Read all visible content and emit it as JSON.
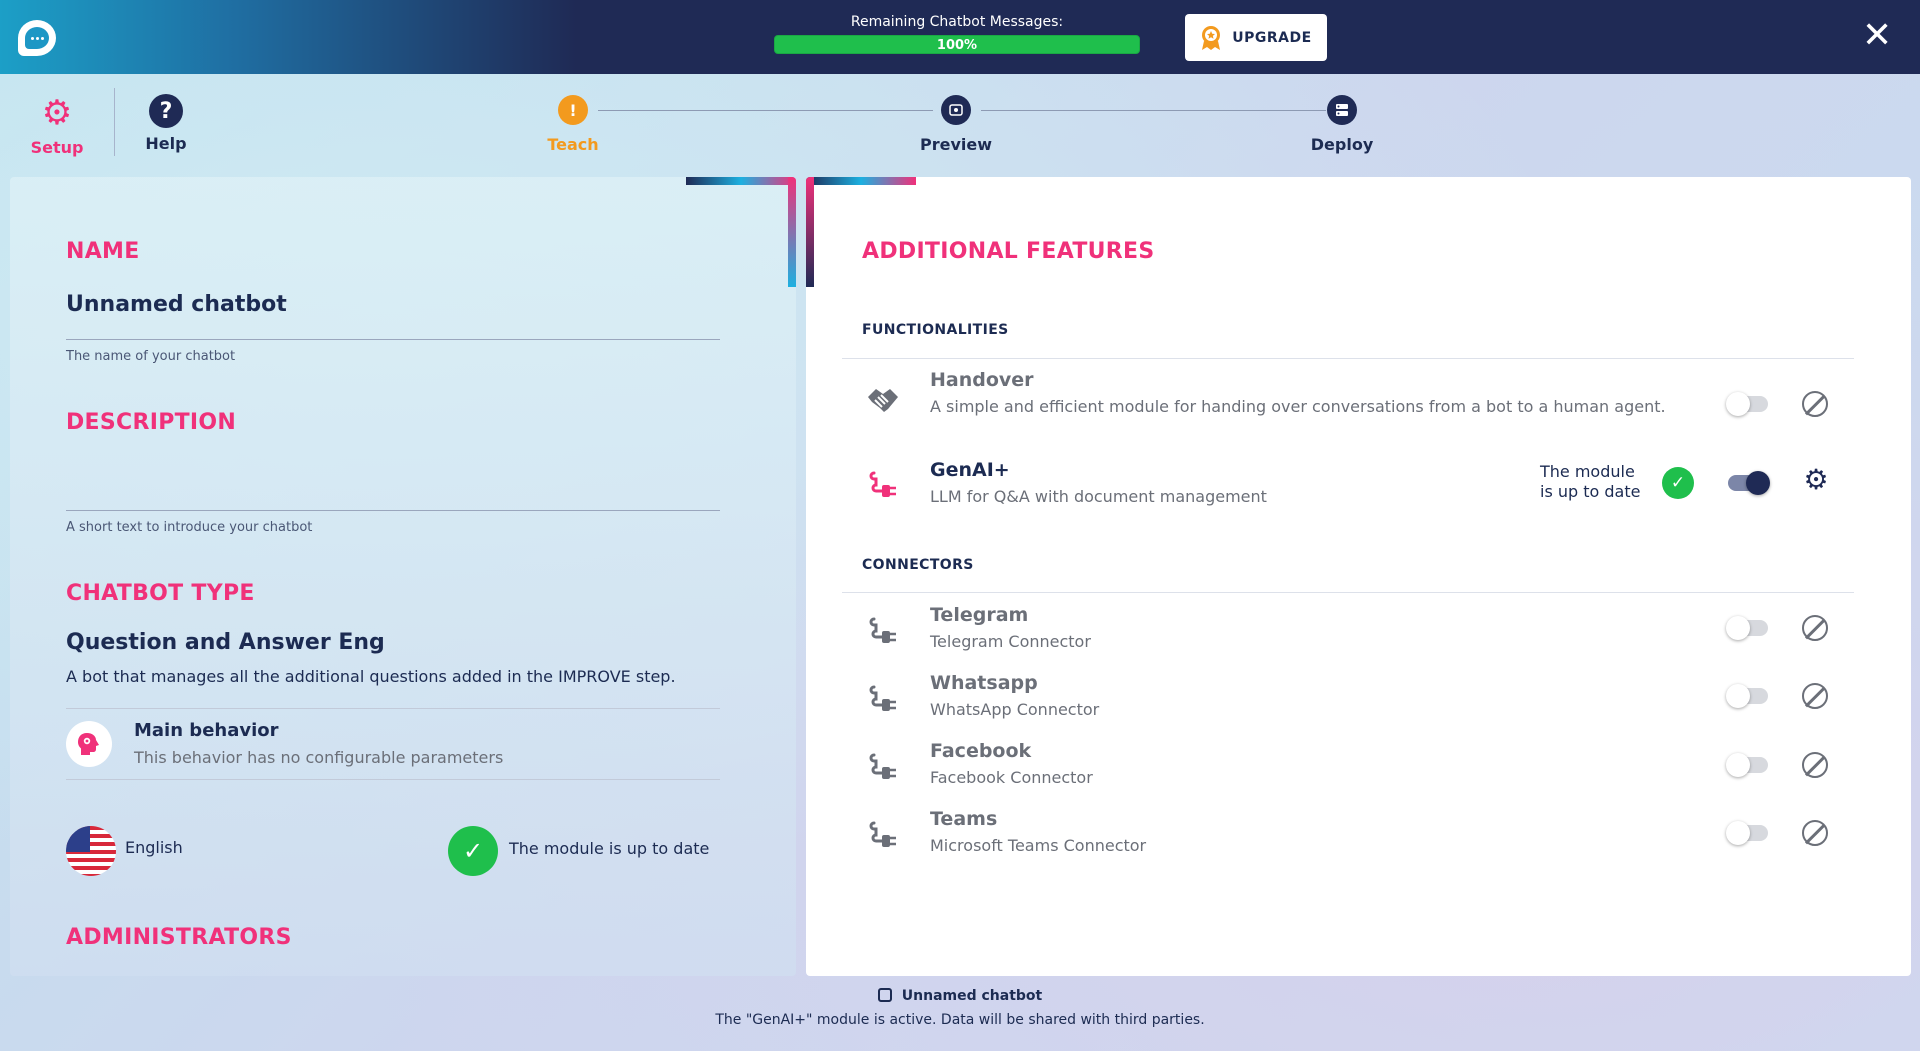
{
  "topbar": {
    "quota_label": "Remaining Chatbot Messages:",
    "quota_value": "100%",
    "quota_fraction": 1.0,
    "upgrade_label": "UPGRADE",
    "close_icon": "close-icon"
  },
  "nav": {
    "setup": "Setup",
    "help": "Help"
  },
  "steps": [
    {
      "label": "Teach",
      "state": "warning",
      "color": "#f39a1e"
    },
    {
      "label": "Preview",
      "state": "default",
      "color": "#1f2a55"
    },
    {
      "label": "Deploy",
      "state": "default",
      "color": "#1f2a55"
    }
  ],
  "left": {
    "name_title": "NAME",
    "name_value": "Unnamed chatbot",
    "name_hint": "The name of your chatbot",
    "description_title": "DESCRIPTION",
    "description_value": "",
    "description_hint": "A short text to introduce your chatbot",
    "type_title": "CHATBOT TYPE",
    "type_value": "Question and Answer Eng",
    "type_desc": "A bot that manages all the additional questions added in the IMPROVE step.",
    "behavior_title": "Main behavior",
    "behavior_desc": "This behavior has no configurable parameters",
    "language": "English",
    "module_status": "The module is up to date",
    "admins_title": "ADMINISTRATORS"
  },
  "right": {
    "title": "ADDITIONAL FEATURES",
    "functionalities_title": "FUNCTIONALITIES",
    "connectors_title": "CONNECTORS",
    "functionalities": [
      {
        "name": "Handover",
        "desc": "A simple and efficient module for handing over conversations from a bot to a human agent.",
        "enabled": false
      },
      {
        "name": "GenAI+",
        "desc": "LLM for Q&A with document management",
        "enabled": true,
        "status_line1": "The module",
        "status_line2": "is up to date"
      }
    ],
    "connectors": [
      {
        "name": "Telegram",
        "desc": "Telegram Connector",
        "enabled": false
      },
      {
        "name": "Whatsapp",
        "desc": "WhatsApp Connector",
        "enabled": false
      },
      {
        "name": "Facebook",
        "desc": "Facebook Connector",
        "enabled": false
      },
      {
        "name": "Teams",
        "desc": "Microsoft Teams Connector",
        "enabled": false
      }
    ]
  },
  "footer": {
    "bot_name": "Unnamed chatbot",
    "notice": "The \"GenAI+\" module is active. Data will be shared with third parties."
  },
  "colors": {
    "accent_pink": "#f0317a",
    "navy": "#1c2b52",
    "success_green": "#1fbf4c",
    "warning_orange": "#f39a1e"
  }
}
